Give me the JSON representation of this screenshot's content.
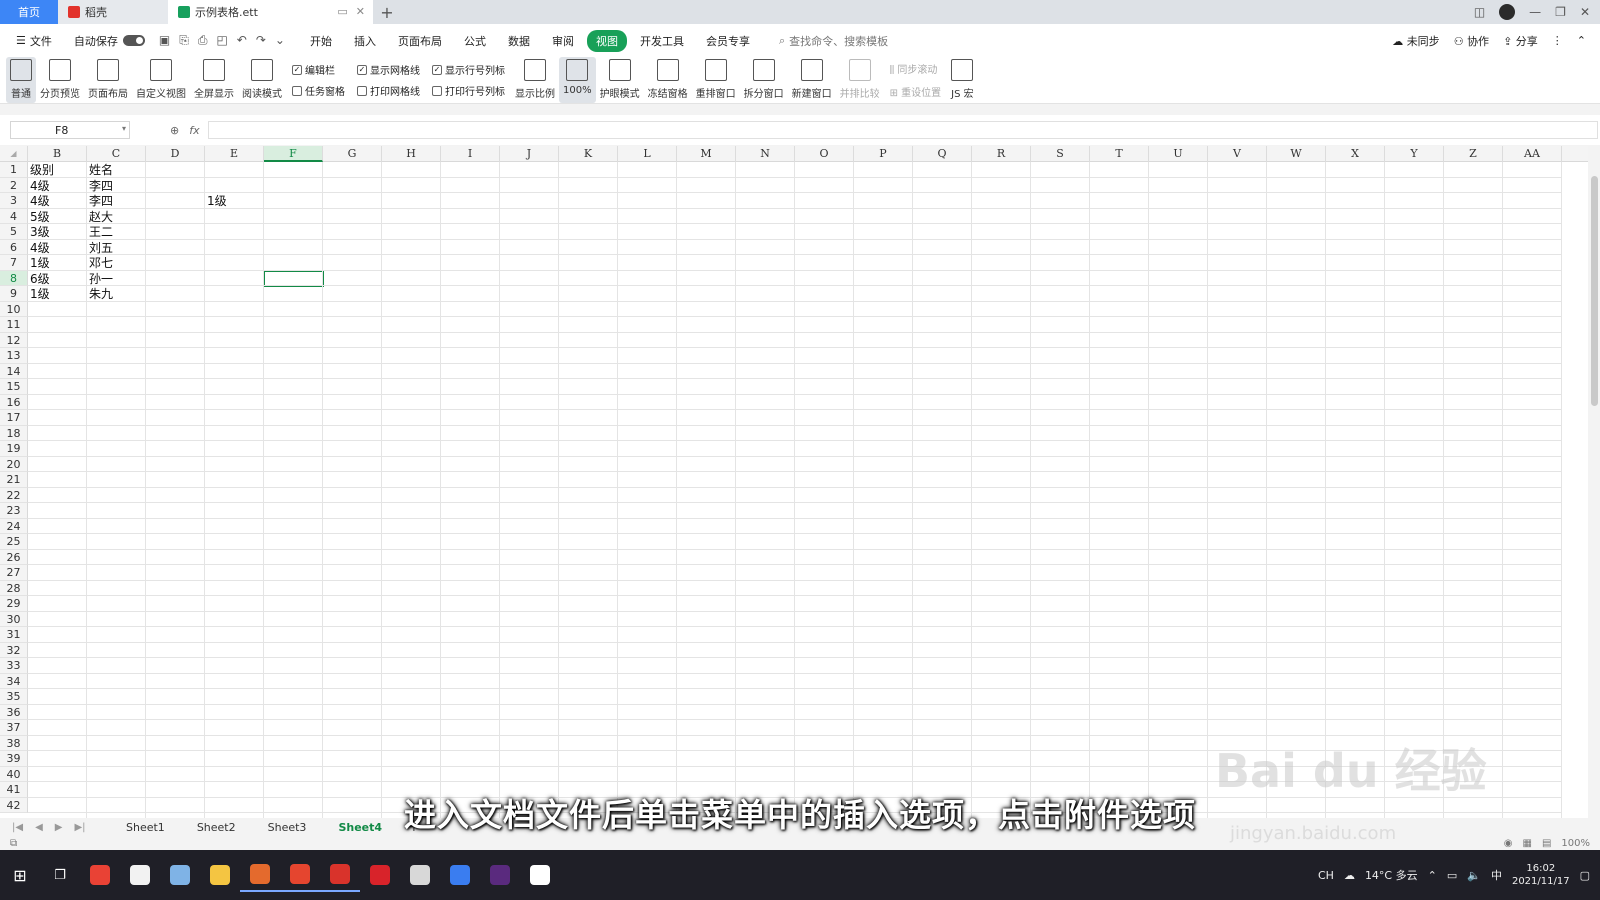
{
  "tabbar": {
    "home_label": "首页",
    "wps_label": "稻壳",
    "doc_label": "示例表格.ett"
  },
  "menubar": {
    "file_label": "文件",
    "autosave_label": "自动保存",
    "tabs": [
      "开始",
      "插入",
      "页面布局",
      "公式",
      "数据",
      "审阅",
      "视图",
      "开发工具",
      "会员专享"
    ],
    "active_tab": "视图",
    "search_placeholder": "查找命令、搜索模板",
    "sync_label": "未同步",
    "collab_label": "协作",
    "share_label": "分享"
  },
  "ribbon": {
    "normal": "普通",
    "page_break": "分页预览",
    "page_layout": "页面布局",
    "custom_view": "自定义视图",
    "fullscreen": "全屏显示",
    "reading_mode": "阅读模式",
    "checks_col1": [
      {
        "label": "编辑栏",
        "checked": true
      },
      {
        "label": "任务窗格",
        "checked": false
      }
    ],
    "checks_col2": [
      {
        "label": "显示网格线",
        "checked": true
      },
      {
        "label": "打印网格线",
        "checked": false
      }
    ],
    "checks_col3": [
      {
        "label": "显示行号列标",
        "checked": true
      },
      {
        "label": "打印行号列标",
        "checked": false
      }
    ],
    "display_ratio": "显示比例",
    "zoom_100": "100%",
    "eye_mode": "护眼模式",
    "freeze": "冻结窗格",
    "rearrange": "重排窗口",
    "split": "拆分窗口",
    "new_window": "新建窗口",
    "compare": "并排比较",
    "sync_scroll": "同步滚动",
    "reset_pos": "重设位置",
    "js_macro": "JS 宏"
  },
  "formulabar": {
    "name_box": "F8",
    "fx_label": "fx"
  },
  "grid": {
    "columns": [
      "B",
      "C",
      "D",
      "E",
      "F",
      "G",
      "H",
      "I",
      "J",
      "K",
      "L",
      "M",
      "N",
      "O",
      "P",
      "Q",
      "R",
      "S",
      "T",
      "U",
      "V",
      "W",
      "X",
      "Y",
      "Z",
      "AA"
    ],
    "selected_column": "F",
    "selected_row": 8,
    "row_numbers": [
      "1",
      "2",
      "3",
      "4",
      "5",
      "6",
      "7",
      "8",
      "9",
      "10",
      "11",
      "12",
      "13",
      "14",
      "15",
      "16",
      "17",
      "18",
      "19",
      "20",
      "21",
      "22",
      "23",
      "24",
      "25",
      "26",
      "27",
      "28",
      "29",
      "30",
      "31",
      "32",
      "33",
      "34",
      "35",
      "36",
      "37",
      "38",
      "39",
      "40",
      "41",
      "42"
    ],
    "col_b": [
      "级别",
      "4级",
      "4级",
      "5级",
      "3级",
      "4级",
      "1级",
      "6级",
      "1级"
    ],
    "col_c": [
      "姓名",
      "李四",
      "李四",
      "赵大",
      "王二",
      "刘五",
      "邓七",
      "孙一",
      "朱九"
    ],
    "e3": "1级"
  },
  "sheets": {
    "tabs": [
      "Sheet1",
      "Sheet2",
      "Sheet3",
      "Sheet4"
    ],
    "active": "Sheet4"
  },
  "statusbar": {
    "zoom": "100%"
  },
  "taskbar": {
    "weather": "14°C 多云",
    "ime": "中",
    "lang": "CH",
    "time": "16:02",
    "date": "2021/11/17",
    "apps": [
      {
        "name": "chrome",
        "color": "#e94235"
      },
      {
        "name": "store",
        "color": "#f2f2f2"
      },
      {
        "name": "notes",
        "color": "#7fb3e6"
      },
      {
        "name": "explorer",
        "color": "#f4c542"
      },
      {
        "name": "wps-et",
        "color": "#e46a2d"
      },
      {
        "name": "wps-ppt",
        "color": "#e5452f"
      },
      {
        "name": "wps",
        "color": "#d9332b"
      },
      {
        "name": "netease-music",
        "color": "#d8232a"
      },
      {
        "name": "calendar",
        "color": "#d8d8d8"
      },
      {
        "name": "chrome-2",
        "color": "#3a7df0"
      },
      {
        "name": "premiere",
        "color": "#5a2a7e"
      },
      {
        "name": "app-a",
        "color": "#ffffff"
      }
    ]
  },
  "overlay": {
    "subtitle": "进入文档文件后单击菜单中的插入选项，点击附件选项",
    "watermark": "Bai du 经验",
    "watermark_url": "jingyan.baidu.com"
  }
}
